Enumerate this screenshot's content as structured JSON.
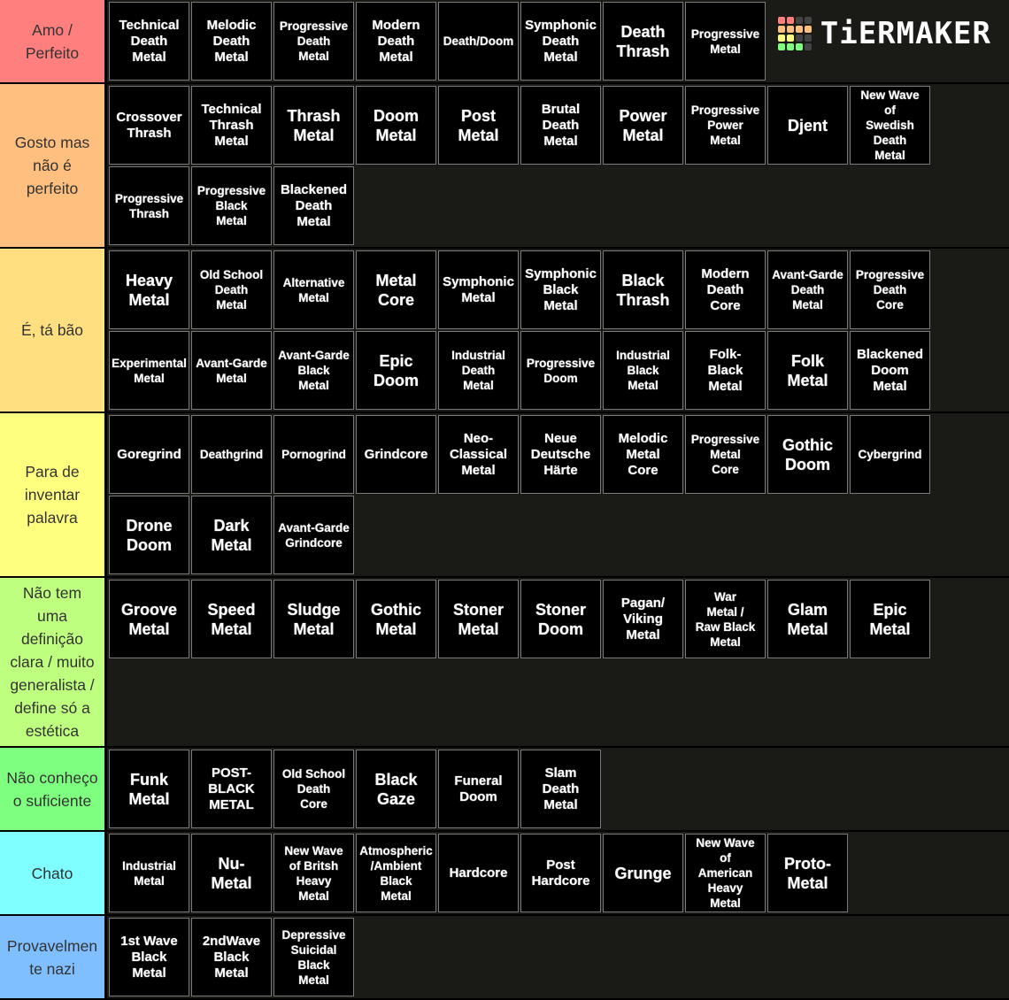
{
  "app": {
    "logo_text": "TiERMAKER"
  },
  "logo_colors": [
    "#ff7f7f",
    "#ff7f7f",
    "#444444",
    "#444444",
    "#ffbf7f",
    "#ffbf7f",
    "#ffbf7f",
    "#ffbf7f",
    "#ffff7f",
    "#ffff7f",
    "#444444",
    "#444444",
    "#7fff7f",
    "#7fff7f",
    "#7fff7f",
    "#444444"
  ],
  "tiers": [
    {
      "label": "Amo /\nPerfeito",
      "color": "#ff7f7f",
      "items": [
        "Technical\nDeath\nMetal",
        "Melodic\nDeath\nMetal",
        "Progressive\nDeath\nMetal",
        "Modern\nDeath\nMetal",
        "Death/Doom",
        "Symphonic\nDeath\nMetal",
        "Death\nThrash",
        "Progressive\nMetal"
      ]
    },
    {
      "label": "Gosto mas\nnão é\nperfeito",
      "color": "#ffbf7f",
      "items": [
        "Crossover\nThrash",
        "Technical\nThrash\nMetal",
        "Thrash\nMetal",
        "Doom\nMetal",
        "Post\nMetal",
        "Brutal\nDeath\nMetal",
        "Power\nMetal",
        "Progressive\nPower\nMetal",
        "Djent",
        "New Wave\nof\nSwedish\nDeath\nMetal",
        "Progressive\nThrash",
        "Progressive\nBlack\nMetal",
        "Blackened\nDeath\nMetal"
      ]
    },
    {
      "label": "É, tá bão",
      "color": "#ffdf7f",
      "items": [
        "Heavy\nMetal",
        "Old School\nDeath\nMetal",
        "Alternative\nMetal",
        "Metal\nCore",
        "Symphonic\nMetal",
        "Symphonic\nBlack\nMetal",
        "Black\nThrash",
        "Modern\nDeath\nCore",
        "Avant-Garde\nDeath\nMetal",
        "Progressive\nDeath\nCore",
        "Experimental\nMetal",
        "Avant-Garde\nMetal",
        "Avant-Garde\nBlack\nMetal",
        "Epic\nDoom",
        "Industrial\nDeath\nMetal",
        "Progressive\nDoom",
        "Industrial\nBlack\nMetal",
        "Folk-\nBlack\nMetal",
        "Folk\nMetal",
        "Blackened\nDoom\nMetal"
      ]
    },
    {
      "label": "Para de\ninventar\npalavra",
      "color": "#ffff7f",
      "items": [
        "Goregrind",
        "Deathgrind",
        "Pornogrind",
        "Grindcore",
        "Neo-\nClassical\nMetal",
        "Neue\nDeutsche\nHärte",
        "Melodic\nMetal\nCore",
        "Progressive\nMetal\nCore",
        "Gothic\nDoom",
        "Cybergrind",
        "Drone\nDoom",
        "Dark\nMetal",
        "Avant-Garde\nGrindcore"
      ]
    },
    {
      "label": "Não tem\numa\ndefinição\nclara / muito\ngeneralista /\ndefine só a\nestética",
      "color": "#bfff7f",
      "items": [
        "Groove\nMetal",
        "Speed\nMetal",
        "Sludge\nMetal",
        "Gothic\nMetal",
        "Stoner\nMetal",
        "Stoner\nDoom",
        "Pagan/\nViking\nMetal",
        "War\nMetal /\nRaw Black\nMetal",
        "Glam\nMetal",
        "Epic\nMetal"
      ]
    },
    {
      "label": "Não conheço\no suficiente",
      "color": "#7fff7f",
      "items": [
        "Funk\nMetal",
        "POST-\nBLACK\nMETAL",
        "Old School\nDeath\nCore",
        "Black\nGaze",
        "Funeral\nDoom",
        "Slam\nDeath\nMetal"
      ]
    },
    {
      "label": "Chato",
      "color": "#7fffff",
      "items": [
        "Industrial\nMetal",
        "Nu-\nMetal",
        "New Wave\nof Britsh\nHeavy\nMetal",
        "Atmospheric\n/Ambient\nBlack\nMetal",
        "Hardcore",
        "Post\nHardcore",
        "Grunge",
        "New Wave\nof\nAmerican\nHeavy\nMetal",
        "Proto-\nMetal"
      ]
    },
    {
      "label": "Provavelmen\nte nazi",
      "color": "#7fbfff",
      "items": [
        "1st Wave\nBlack\nMetal",
        "2ndWave\nBlack\nMetal",
        "Depressive\nSuicidal\nBlack\nMetal"
      ]
    }
  ]
}
